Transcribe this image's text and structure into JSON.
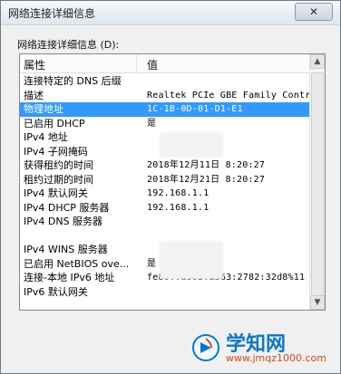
{
  "window": {
    "title": "网络连接详细信息",
    "close_label": "✕"
  },
  "dialog": {
    "section_label": "网络连接详细信息 (D):"
  },
  "table": {
    "columns": [
      "属性",
      "值"
    ],
    "rows": [
      {
        "property": "连接特定的 DNS 后缀",
        "value": ""
      },
      {
        "property": "描述",
        "value": "Realtek PCIe GBE Family Contro"
      },
      {
        "property": "物理地址",
        "value": "1C-1B-0D-01-D1-E1"
      },
      {
        "property": "已启用 DHCP",
        "value": "是"
      },
      {
        "property": "IPv4 地址",
        "value": ""
      },
      {
        "property": "IPv4 子网掩码",
        "value": ""
      },
      {
        "property": "获得租约的时间",
        "value": "2018年12月11日 8:20:27"
      },
      {
        "property": "租约过期的时间",
        "value": "2018年12月21日 8:20:27"
      },
      {
        "property": "IPv4 默认网关",
        "value": "192.168.1.1"
      },
      {
        "property": "IPv4 DHCP 服务器",
        "value": "192.168.1.1"
      },
      {
        "property": "IPv4 DNS 服务器",
        "value": ""
      },
      {
        "property": "",
        "value": ""
      },
      {
        "property": "IPv4 WINS 服务器",
        "value": ""
      },
      {
        "property": "已启用 NetBIOS ove...",
        "value": "是"
      },
      {
        "property": "连接-本地 IPv6 地址",
        "value": "fe80::d903:a363:2782:32d8%11"
      },
      {
        "property": "IPv6 默认网关",
        "value": ""
      }
    ],
    "selected_index": 2
  },
  "watermark": {
    "name": "学知网",
    "url": "www.jmqz1000.com"
  }
}
